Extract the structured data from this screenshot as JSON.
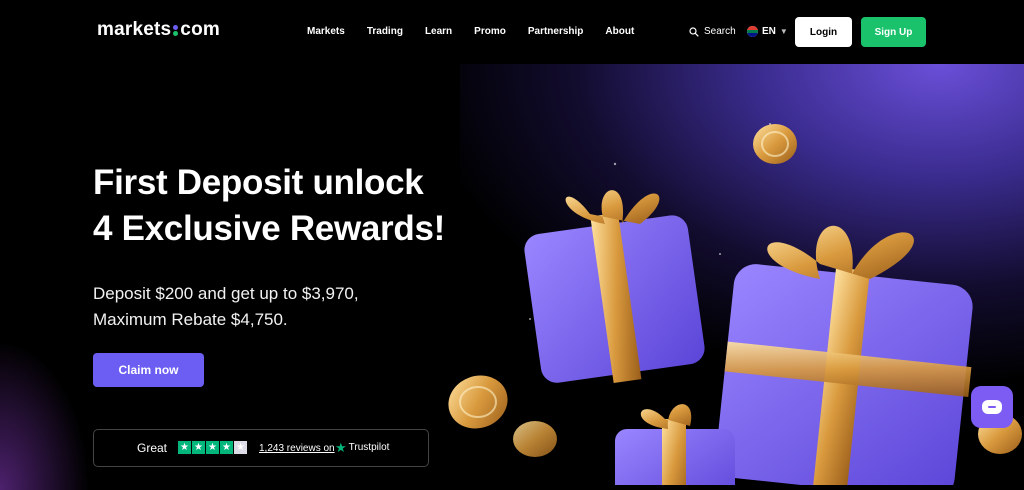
{
  "brand": {
    "logo_left": "markets",
    "logo_right": "com",
    "accent": "#6c5ef2",
    "green": "#19c26b"
  },
  "nav": {
    "items": [
      "Markets",
      "Trading",
      "Learn",
      "Promo",
      "Partnership",
      "About"
    ],
    "search_label": "Search",
    "language": "EN",
    "login_label": "Login",
    "signup_label": "Sign Up"
  },
  "hero": {
    "headline_line1": "First Deposit unlock",
    "headline_line2": "4 Exclusive Rewards!",
    "subline_line1": "Deposit $200 and get up to $3,970,",
    "subline_line2": "Maximum Rebate $4,750.",
    "cta_label": "Claim now"
  },
  "trustpilot": {
    "rating_word": "Great",
    "stars_filled": 4,
    "stars_total": 5,
    "reviews_text": "1,243 reviews on",
    "brand": "Trustpilot"
  },
  "icons": {
    "search": "search-icon",
    "flag": "south-africa-flag-icon",
    "chevron": "chevron-down-icon",
    "chat": "chat-icon"
  }
}
